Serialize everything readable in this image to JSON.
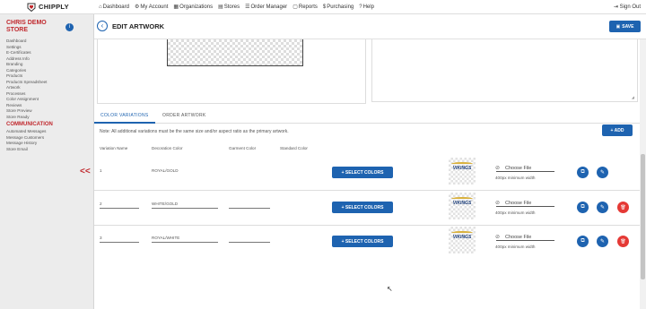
{
  "brand": {
    "name": "CHIPPLY"
  },
  "nav": [
    {
      "icon": "⌂",
      "label": "Dashboard"
    },
    {
      "icon": "⚙",
      "label": "My Account"
    },
    {
      "icon": "▦",
      "label": "Organizations"
    },
    {
      "icon": "▤",
      "label": "Stores"
    },
    {
      "icon": "☰",
      "label": "Order Manager"
    },
    {
      "icon": "▢",
      "label": "Reports"
    },
    {
      "icon": "$",
      "label": "Purchasing"
    },
    {
      "icon": "?",
      "label": "Help"
    }
  ],
  "signout": {
    "label": "Sign Out"
  },
  "sidebar": {
    "store_name": "CHRIS DEMO STORE",
    "info_icon": "i",
    "items": [
      "Dashboard",
      "Settings",
      "E-Certificates",
      "Address Info",
      "Branding",
      "Categories",
      "Products",
      "Products Spreadsheet",
      "Artwork",
      "Processes",
      "Color Assignment",
      "Reviews",
      "Store Preview",
      "Store Ready"
    ],
    "communication_heading": "COMMUNICATION",
    "communication_items": [
      "Automated Messages",
      "Message Customers",
      "Message History",
      "Store Email"
    ],
    "collapse_icon": "<<"
  },
  "header": {
    "back_icon": "‹",
    "title": "EDIT ARTWORK",
    "save_label": "SAVE"
  },
  "tabs": [
    {
      "label": "COLOR VARIATIONS"
    },
    {
      "label": "ORDER ARTWORK"
    }
  ],
  "note": "Note: All additional variations must be the same size and/or aspect ratio as the primary artwork.",
  "add_label": "+ ADD",
  "columns": {
    "variation_name": "Variation Name",
    "decoration_color": "Decoration Color",
    "garment_color": "Garment Color",
    "standard_color": "Standard Color"
  },
  "rows": [
    {
      "name": "1",
      "decoration": "ROYAL/GOLD",
      "garment": "",
      "select_label": "+ SELECT COLORS",
      "thumb_text": "VIKINGS",
      "file_label": "Choose File",
      "file_hint": "400px minimum width",
      "deletable": false
    },
    {
      "name": "2",
      "decoration": "WHITE/GOLD",
      "garment": "",
      "select_label": "+ SELECT COLORS",
      "thumb_text": "VIKINGS",
      "file_label": "Choose File",
      "file_hint": "400px minimum width",
      "deletable": true
    },
    {
      "name": "3",
      "decoration": "ROYAL/WHITE",
      "garment": "",
      "select_label": "+ SELECT COLORS",
      "thumb_text": "VIKINGS",
      "file_label": "Choose File",
      "file_hint": "400px minimum width",
      "deletable": true
    }
  ],
  "icons": {
    "copy": "⧉",
    "edit": "✎",
    "delete": "🗑",
    "clip": "⊘"
  }
}
